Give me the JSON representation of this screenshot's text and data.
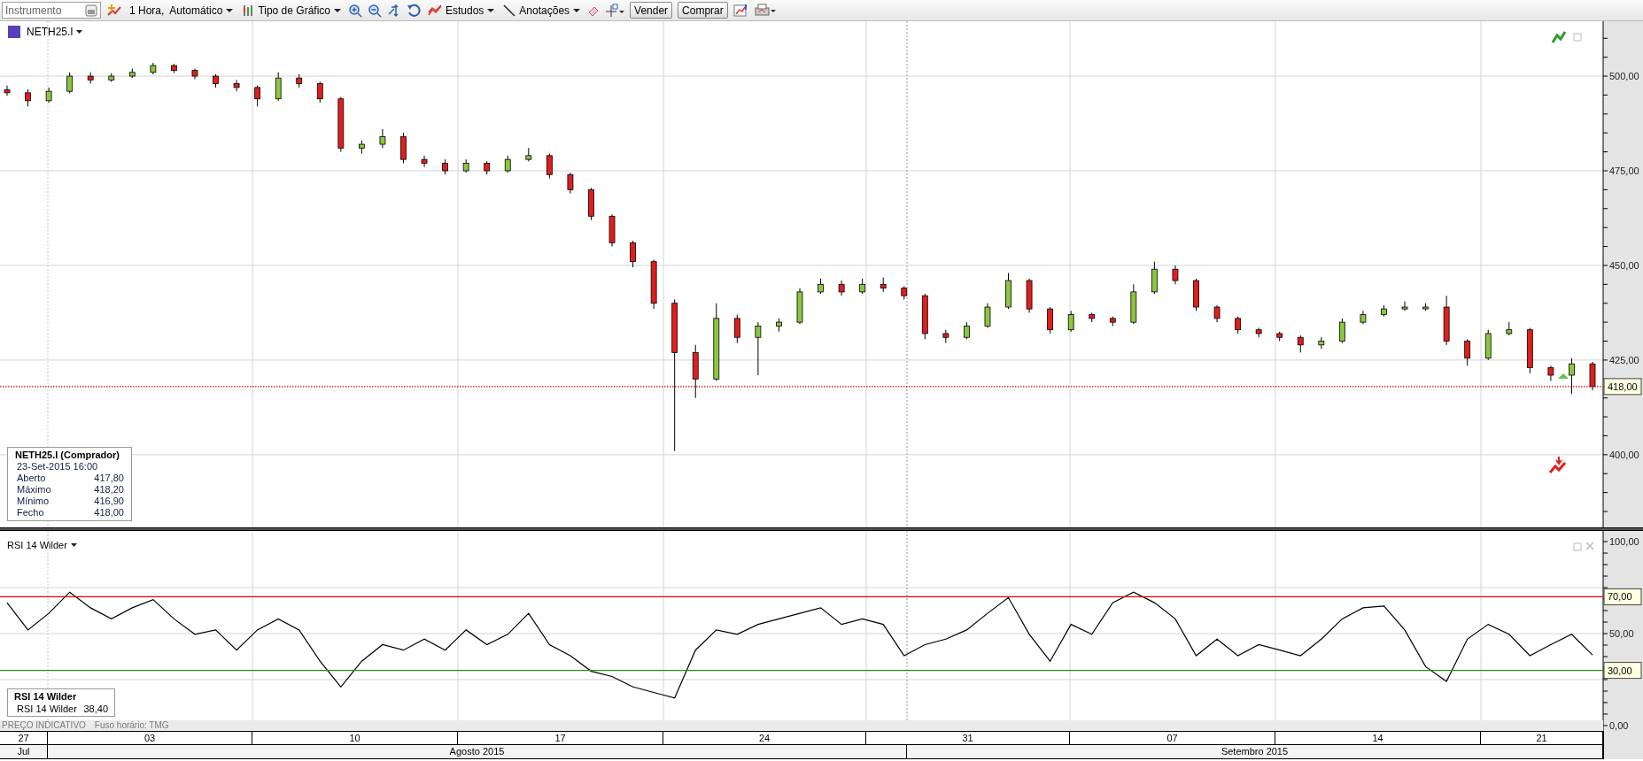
{
  "toolbar": {
    "instrument_placeholder": "Instrumento",
    "interval": "1 Hora,  Automático",
    "chart_type": "Tipo de Gráfico",
    "studies": "Estudos",
    "annotations": "Anotações",
    "sell": "Vender",
    "buy": "Comprar"
  },
  "price_pane": {
    "info_box": {
      "title": "NETH25.I (Comprador)",
      "datetime": "23-Set-2015 16:00",
      "rows": [
        {
          "label": "Aberto",
          "value": "417,80"
        },
        {
          "label": "Máximo",
          "value": "418,20"
        },
        {
          "label": "Mínimo",
          "value": "416,90"
        },
        {
          "label": "Fecho",
          "value": "418,00"
        }
      ]
    },
    "chart_data": {
      "type": "candlestick",
      "grid": true,
      "ylim": [
        380.8,
        514.5
      ],
      "yticks": [
        {
          "value": 400,
          "label": "400,00"
        },
        {
          "value": 425,
          "label": "425,00"
        },
        {
          "value": 450,
          "label": "450,00"
        },
        {
          "value": 475,
          "label": "475,00"
        },
        {
          "value": 500,
          "label": "500,00"
        }
      ],
      "ref_lines": [
        {
          "axis": "y",
          "value": 418,
          "color": "#e00000",
          "label": "418,00"
        }
      ],
      "series": [
        {
          "name": "NETH25.I",
          "color": "#000000",
          "ohlc": [
            [
              496.4,
              497.5,
              494.8,
              495.6
            ],
            [
              495.6,
              496.5,
              492,
              493.5
            ],
            [
              493.5,
              497,
              493,
              496
            ],
            [
              496,
              501,
              495.5,
              500
            ],
            [
              500,
              501,
              498,
              499
            ],
            [
              499,
              500.8,
              498.5,
              500
            ],
            [
              500,
              502,
              499.5,
              501
            ],
            [
              501,
              503.5,
              500.5,
              502.8
            ],
            [
              502.8,
              503.2,
              500.8,
              501.5
            ],
            [
              501.5,
              502,
              499.2,
              500
            ],
            [
              500,
              500.5,
              497,
              498
            ],
            [
              498,
              499,
              496,
              497
            ],
            [
              497,
              497.5,
              492,
              494
            ],
            [
              494,
              501,
              493.5,
              499.5
            ],
            [
              499.5,
              500.5,
              497,
              498
            ],
            [
              498,
              498.5,
              493,
              494
            ],
            [
              494,
              494.5,
              480,
              481
            ],
            [
              481,
              483,
              479.5,
              482
            ],
            [
              482,
              486,
              481,
              484
            ],
            [
              484,
              485,
              477,
              478
            ],
            [
              478,
              479,
              476,
              477
            ],
            [
              477,
              478,
              474,
              475
            ],
            [
              475,
              478,
              474.5,
              477
            ],
            [
              477,
              477.5,
              474,
              475
            ],
            [
              475,
              479,
              474.5,
              478
            ],
            [
              478,
              481,
              477.5,
              479
            ],
            [
              479,
              479.5,
              473,
              474
            ],
            [
              474,
              474.5,
              469,
              470
            ],
            [
              470,
              470.5,
              462,
              463
            ],
            [
              463,
              463.5,
              455,
              456
            ],
            [
              456,
              456.5,
              449.5,
              451
            ],
            [
              451,
              451.5,
              438.5,
              440
            ],
            [
              440,
              441,
              401,
              427
            ],
            [
              427,
              429,
              415,
              420
            ],
            [
              420,
              440,
              419.5,
              436
            ],
            [
              436,
              437,
              429.5,
              431
            ],
            [
              431,
              435,
              421,
              434
            ],
            [
              434,
              436,
              432.5,
              435
            ],
            [
              435,
              444,
              434.5,
              443
            ],
            [
              443,
              446.5,
              442.5,
              445
            ],
            [
              445,
              446,
              442,
              443
            ],
            [
              443,
              446.5,
              442.5,
              445
            ],
            [
              445,
              446.8,
              443,
              444
            ],
            [
              444,
              444.5,
              441,
              442
            ],
            [
              442,
              442.5,
              430.5,
              432
            ],
            [
              432,
              433,
              429.5,
              431
            ],
            [
              431,
              435,
              430.5,
              434
            ],
            [
              434,
              440,
              433.5,
              439
            ],
            [
              439,
              448,
              438.5,
              446
            ],
            [
              446,
              446.5,
              437.5,
              438.5
            ],
            [
              438.5,
              439,
              432,
              433
            ],
            [
              433,
              438,
              432.5,
              437
            ],
            [
              437,
              437.5,
              435,
              436
            ],
            [
              436,
              436.5,
              434,
              435
            ],
            [
              435,
              445,
              434.5,
              443
            ],
            [
              443,
              451,
              442.5,
              449
            ],
            [
              449,
              450,
              445,
              446
            ],
            [
              446,
              446.5,
              438,
              439
            ],
            [
              439,
              439.5,
              435,
              436
            ],
            [
              436,
              436.5,
              432,
              433
            ],
            [
              433,
              433.5,
              431,
              432
            ],
            [
              432,
              432.5,
              430,
              431
            ],
            [
              431,
              431.5,
              427,
              429
            ],
            [
              429,
              431,
              428,
              430
            ],
            [
              430,
              436,
              429.5,
              435
            ],
            [
              435,
              438,
              434.5,
              437
            ],
            [
              437,
              439.5,
              436.5,
              438.5
            ],
            [
              438.5,
              440.5,
              438,
              439
            ],
            [
              439,
              440,
              438,
              439
            ],
            [
              439,
              442,
              429,
              430
            ],
            [
              430,
              430.5,
              423.5,
              425.5
            ],
            [
              425.5,
              433,
              425,
              432
            ],
            [
              432,
              435,
              431.5,
              433
            ],
            [
              433,
              433.5,
              421.5,
              423
            ],
            [
              423,
              423.5,
              419.5,
              421
            ],
            [
              421,
              425.5,
              416,
              424
            ],
            [
              424,
              424.5,
              417,
              418
            ]
          ]
        }
      ]
    }
  },
  "rsi_pane": {
    "info_box": {
      "title": "RSI 14 Wilder",
      "label": "RSI 14 Wilder",
      "value": "38,40"
    },
    "chart_data": {
      "type": "line",
      "grid": true,
      "ylim": [
        -2.9,
        105.8
      ],
      "yticks": [
        {
          "value": 0,
          "label": "0,00"
        },
        {
          "value": 50,
          "label": "50,00"
        },
        {
          "value": 100,
          "label": "100,00"
        }
      ],
      "ref_lines": [
        {
          "axis": "y",
          "value": 70,
          "color": "#e00000",
          "label": "70,00"
        },
        {
          "axis": "y",
          "value": 30,
          "color": "#2a8a1a",
          "label": "30,00"
        }
      ],
      "series": [
        {
          "name": "RSI 14 Wilder",
          "color": "#000000",
          "values": [
            66.8,
            52,
            61,
            72.5,
            64,
            58,
            64,
            68.5,
            58,
            49.6,
            52,
            41,
            52,
            58,
            52,
            35,
            21,
            35,
            44,
            41,
            47,
            41,
            52,
            44,
            49.6,
            61,
            44,
            38,
            29.5,
            26.7,
            21,
            18,
            15,
            41,
            52,
            49.6,
            55,
            58,
            61,
            64,
            55,
            58,
            55,
            38,
            44,
            47,
            52,
            61,
            69.6,
            49.6,
            35,
            55,
            49.6,
            66.8,
            72.5,
            66.8,
            58,
            38,
            47,
            38,
            44,
            41,
            38,
            47,
            58,
            64,
            65,
            52,
            32,
            24,
            47,
            55,
            49.6,
            38,
            44,
            49.6,
            38.4
          ]
        }
      ]
    }
  },
  "status_bar": {
    "price_note": "PREÇO INDICATIVO",
    "timezone": "Fuso horário: TMG"
  },
  "timeline": {
    "days": [
      "27",
      "03",
      "10",
      "17",
      "24",
      "31",
      "07",
      "14",
      "21"
    ],
    "months": [
      "Jul",
      "Agosto 2015",
      "Setembro 2015"
    ]
  }
}
